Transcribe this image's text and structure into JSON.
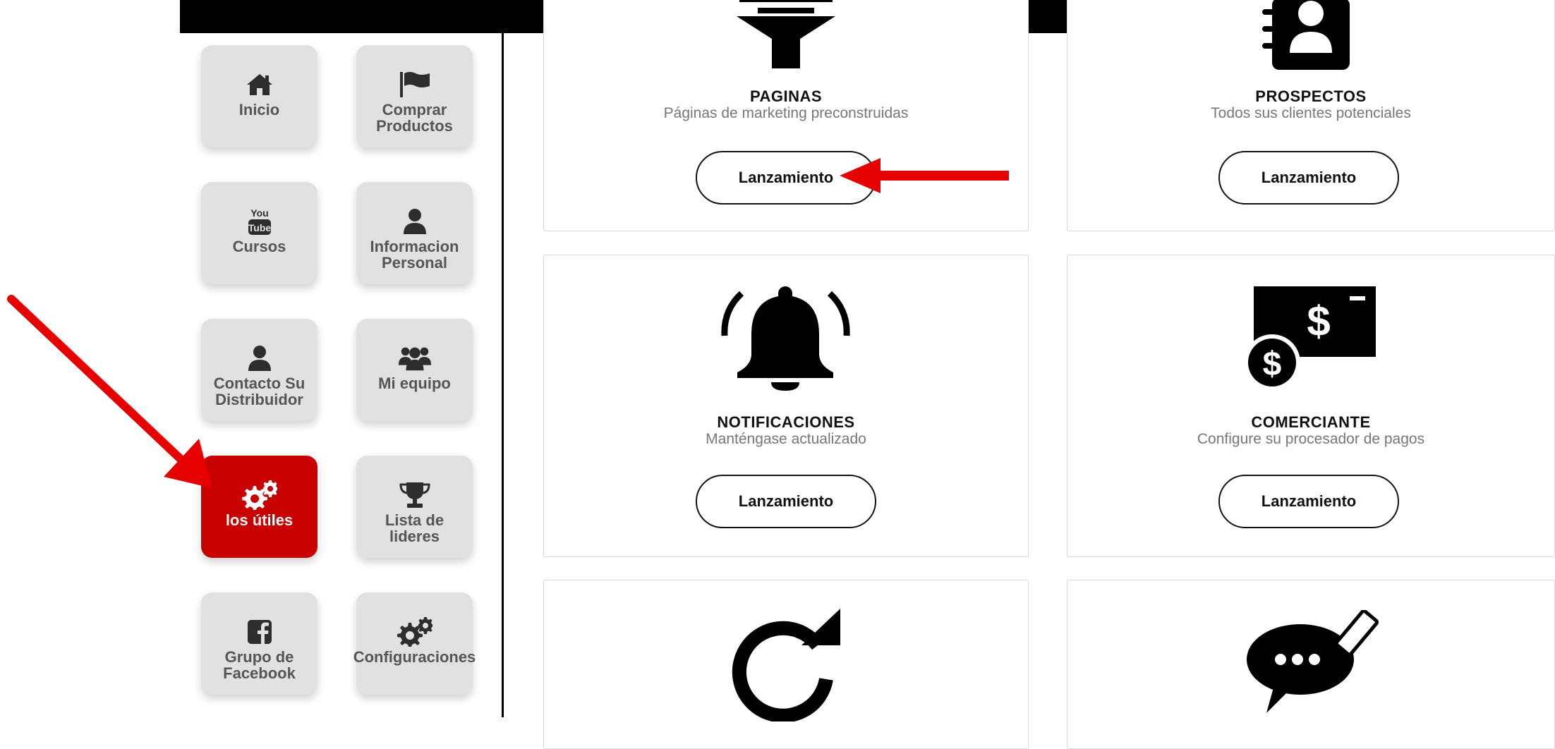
{
  "sidebar": {
    "items": [
      {
        "label": "Inicio",
        "icon": "home-icon"
      },
      {
        "label": "Comprar\nProductos",
        "icon": "flag-icon"
      },
      {
        "label": "Cursos",
        "icon": "youtube-icon"
      },
      {
        "label": "Informacion\nPersonal",
        "icon": "user-icon"
      },
      {
        "label": "Contacto Su\nDistribuidor",
        "icon": "user-icon"
      },
      {
        "label": "Mi equipo",
        "icon": "team-icon"
      },
      {
        "label": "los útiles",
        "icon": "gears-icon",
        "active": true
      },
      {
        "label": "Lista de\nlideres",
        "icon": "trophy-icon"
      },
      {
        "label": "Grupo de\nFacebook",
        "icon": "facebook-icon"
      },
      {
        "label": "Configuraciones",
        "icon": "gears-icon"
      }
    ],
    "active_color": "#c80000"
  },
  "cards": [
    {
      "title": "PAGINAS",
      "subtitle": "Páginas de marketing preconstruidas",
      "button": "Lanzamiento",
      "icon": "funnel-icon"
    },
    {
      "title": "PROSPECTOS",
      "subtitle": "Todos sus clientes potenciales",
      "button": "Lanzamiento",
      "icon": "contact-book-icon"
    },
    {
      "title": "NOTIFICACIONES",
      "subtitle": "Manténgase actualizado",
      "button": "Lanzamiento",
      "icon": "bell-icon"
    },
    {
      "title": "COMERCIANTE",
      "subtitle": "Configure su procesador de pagos",
      "button": "Lanzamiento",
      "icon": "money-icon"
    },
    {
      "icon": "refresh-icon"
    },
    {
      "icon": "chat-edit-icon"
    }
  ],
  "annotations": {
    "arrow_color": "#e60000",
    "youtube_text_top": "You",
    "youtube_text_bottom": "Tube"
  }
}
